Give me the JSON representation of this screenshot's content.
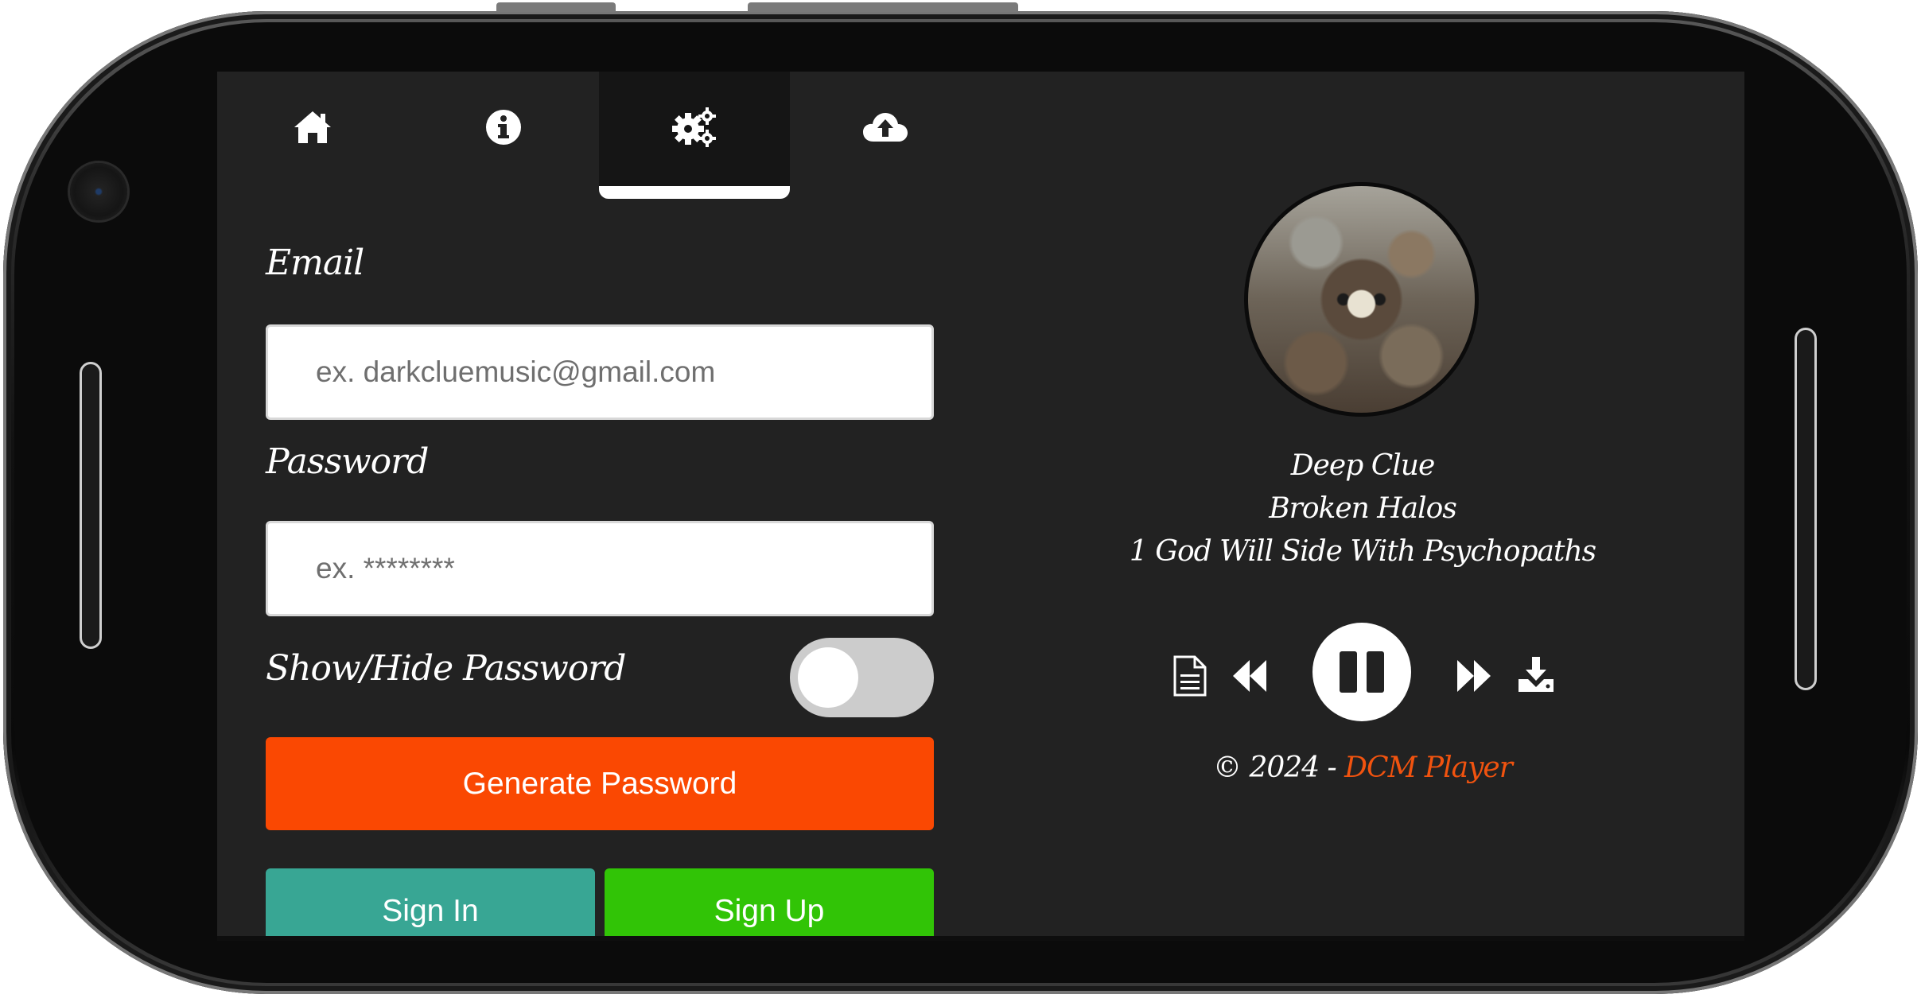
{
  "tabs": [
    {
      "name": "home-icon",
      "active": false
    },
    {
      "name": "info-icon",
      "active": false
    },
    {
      "name": "settings-gears-icon",
      "active": true
    },
    {
      "name": "cloud-upload-icon",
      "active": false
    }
  ],
  "form": {
    "email_label": "Email",
    "email_placeholder": "ex. darkcluemusic@gmail.com",
    "password_label": "Password",
    "password_placeholder": "ex. ********",
    "show_hide_label": "Show/Hide Password",
    "show_password": false,
    "generate_label": "Generate Password",
    "signin_label": "Sign In",
    "signup_label": "Sign Up"
  },
  "player": {
    "artist": "Deep Clue",
    "album": "Broken Halos",
    "track": "1 God Will Side With Psychopaths",
    "state": "playing",
    "controls": [
      "document-icon",
      "rewind-icon",
      "pause-icon",
      "fast-forward-icon",
      "download-icon"
    ]
  },
  "footer": {
    "copyright": "© 2024 - ",
    "brand": "DCM Player"
  },
  "colors": {
    "screen_bg": "#222222",
    "generate": "#fa4802",
    "signin": "#38a694",
    "signup": "#31c406",
    "brand": "#f1530f"
  }
}
